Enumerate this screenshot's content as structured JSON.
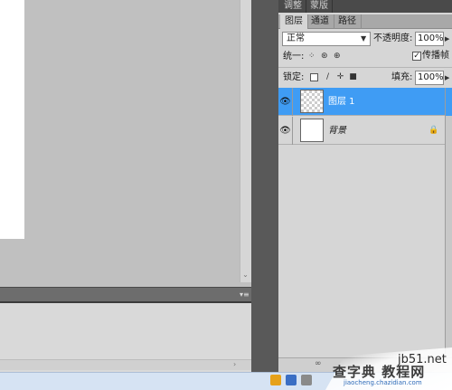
{
  "top_tabs": [
    "调整",
    "蒙版"
  ],
  "panel_tabs": [
    "图层",
    "通道",
    "路径"
  ],
  "blend_mode": "正常",
  "opacity_label": "不透明度:",
  "opacity_value": "100%",
  "unify_label": "统一:",
  "propagate_label": "传播帧",
  "propagate_checked": "✓",
  "lock_label": "锁定:",
  "fill_label": "填充:",
  "fill_value": "100%",
  "layers": [
    {
      "name": "图层 1",
      "selected": true
    },
    {
      "name": "背景",
      "selected": false
    }
  ],
  "watermark": {
    "site": "jb51.net",
    "text": "查字典 教程网",
    "url": "jiaocheng.chazidian.com"
  },
  "icons": [
    "eye-icon",
    "lock-icon",
    "brush-icon",
    "move-icon",
    "chevron-down-icon",
    "link-icon",
    "panel-menu-icon",
    "scroll-arrow-icon"
  ]
}
